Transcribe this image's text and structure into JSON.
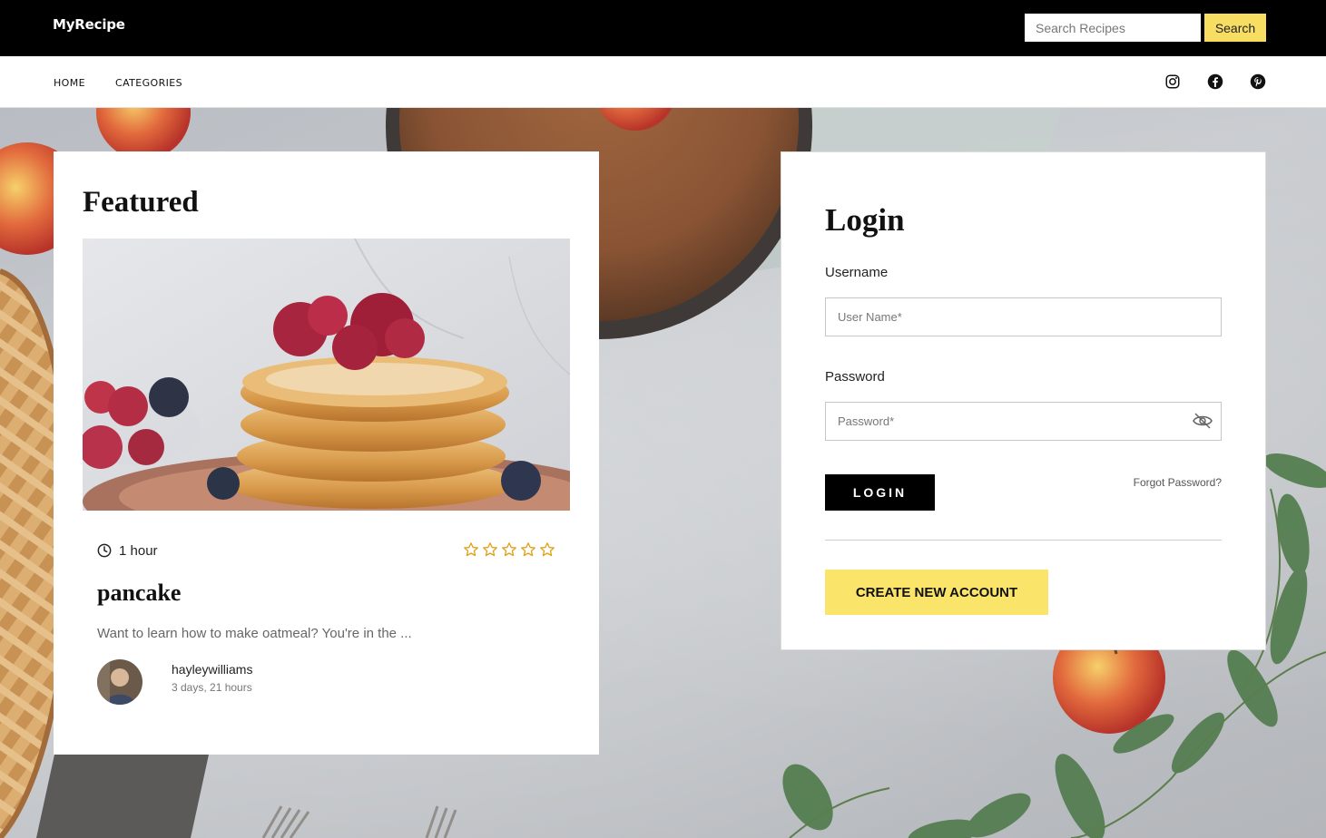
{
  "header": {
    "brand": "MyRecipe",
    "search_placeholder": "Search Recipes",
    "search_button": "Search"
  },
  "nav": {
    "items": [
      {
        "label": "HOME"
      },
      {
        "label": "CATEGORIES"
      }
    ],
    "social": [
      "instagram-icon",
      "facebook-icon",
      "pinterest-icon"
    ]
  },
  "featured": {
    "heading": "Featured",
    "duration": "1 hour",
    "rating": 0,
    "rating_max": 5,
    "recipe_title": "pancake",
    "excerpt": "Want to learn how to make oatmeal? You're in the ...",
    "author": "hayleywilliams",
    "posted": "3 days, 21 hours"
  },
  "login": {
    "heading": "Login",
    "username_label": "Username",
    "username_placeholder": "User Name*",
    "password_label": "Password",
    "password_placeholder": "Password*",
    "login_button": "LOGIN",
    "forgot_link": "Forgot Password?",
    "create_button": "CREATE NEW ACCOUNT"
  },
  "colors": {
    "accent": "#f7dd62",
    "star": "#e0a21a",
    "topbar": "#000000"
  }
}
